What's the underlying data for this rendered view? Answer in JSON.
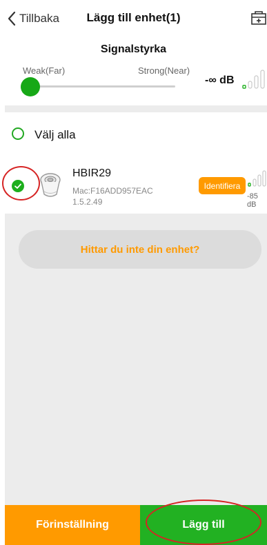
{
  "header": {
    "back_label": "Tillbaka",
    "title": "Lägg till enhet(1)",
    "toolbox_icon": "toolbox-add-icon"
  },
  "signal": {
    "title": "Signalstyrka",
    "weak_label": "Weak(Far)",
    "strong_label": "Strong(Near)",
    "slider_level": 0.0,
    "db_value": "-∞ dB",
    "active_color": "#17a817"
  },
  "select_all": {
    "label": "Välj alla",
    "checked": false
  },
  "devices": [
    {
      "name": "HBIR29",
      "mac": "Mac:F16ADD957EAC",
      "version": "1.5.2.49",
      "identify_label": "Identifiera",
      "rssi": "-85 dB",
      "checked": true
    }
  ],
  "not_found_label": "Hittar du inte din enhet?",
  "footer": {
    "preset_label": "Förinställning",
    "add_label": "Lägg till"
  },
  "colors": {
    "orange": "#ff9a00",
    "green": "#22b122",
    "annotation_red": "#d62424"
  }
}
